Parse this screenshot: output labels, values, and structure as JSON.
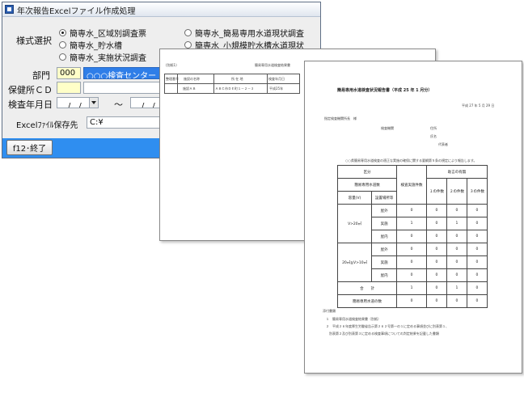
{
  "dialog": {
    "title": "年次報告Excelファイル作成処理",
    "format_label": "様式選択",
    "radio_options": [
      {
        "label": "簡専水_区域別調査票",
        "selected": true
      },
      {
        "label": "簡専水_簡易専用水道現状調査",
        "selected": false
      },
      {
        "label": "簡専水_貯水槽",
        "selected": false
      },
      {
        "label": "簡専水_小規模貯水槽水道現状",
        "selected": false
      },
      {
        "label": "簡専水_実施状況調査",
        "selected": false
      }
    ],
    "dept_label": "部門",
    "dept_code": "000",
    "dept_name": "○○○検査センター",
    "health_center_label": "保健所ＣＤ",
    "health_center_value": "",
    "inspection_date_label": "検査年月日",
    "date_from": "＿/＿/＿",
    "date_separator": "～",
    "date_to": "＿/＿/＿",
    "save_label": "Excelﾌｧｲﾙ保存先",
    "save_path": "C:¥",
    "f12_button": "f12･終了"
  },
  "sheet_middle": {
    "header_left": "(別紙1)",
    "header_right": "簡易専用水道検査結果書",
    "columns": [
      "整理番号",
      "施設の名称",
      "所 在 地",
      "検査年月日"
    ],
    "row": [
      "",
      "施設ＡＢ",
      "ＡＢＣ市ＤＥ町１－２－３",
      "平成25年"
    ]
  },
  "sheet_front": {
    "title": "簡易専用水道検査状況報告書（平成 25 年 1 月分）",
    "date": "平成 27 年 5 月 29 日",
    "addressee": "指定検査機関所長　様",
    "org_label": "検査機関",
    "addr_label": "住所",
    "name_label": "氏名",
    "rep_label": "代表者",
    "intro": "○○県簡易専用水道検査の適正な実施の確保に関する要綱第５条の規定により報告します。",
    "table_title": "区分",
    "head_count": "簡易専用水道数",
    "head_inspected": "検査実施件数",
    "head_advice": "助言の有無",
    "advice_cols": [
      "１の件数",
      "２の件数",
      "３の件数"
    ],
    "capacity_label": "容量(V)",
    "install_label": "設置場所等",
    "install_types": [
      "屋外",
      "屋内",
      "屋外",
      "屋内"
    ],
    "result_types": [
      "実施",
      "無",
      "実施",
      "無"
    ],
    "groups": [
      "V>20㎥",
      "20㎥≧V>10㎥"
    ],
    "grid_rows": [
      [
        "0",
        "0",
        "0",
        "0"
      ],
      [
        "1",
        "0",
        "1",
        "0"
      ],
      [
        "0",
        "0",
        "0",
        "0"
      ],
      [
        "0",
        "0",
        "0",
        "0"
      ],
      [
        "0",
        "0",
        "0",
        "0"
      ],
      [
        "0",
        "0",
        "0",
        "0"
      ]
    ],
    "total_label": "合　　計",
    "total_row": [
      "1",
      "0",
      "1",
      "0"
    ],
    "residual_label": "簡易専用水道の数",
    "residual_row": [
      "0",
      "0",
      "0",
      "0"
    ],
    "notes_title": "添付書類",
    "notes": [
      "１　簡易専用水道検査結果書（別紙）",
      "２　平成２６年度厚生労働省告示第２６２号第一の１に定める事項並びに別表第１、",
      "別表第２及び別表第３に定める検査事項についての判定結果を記載した書類"
    ]
  }
}
